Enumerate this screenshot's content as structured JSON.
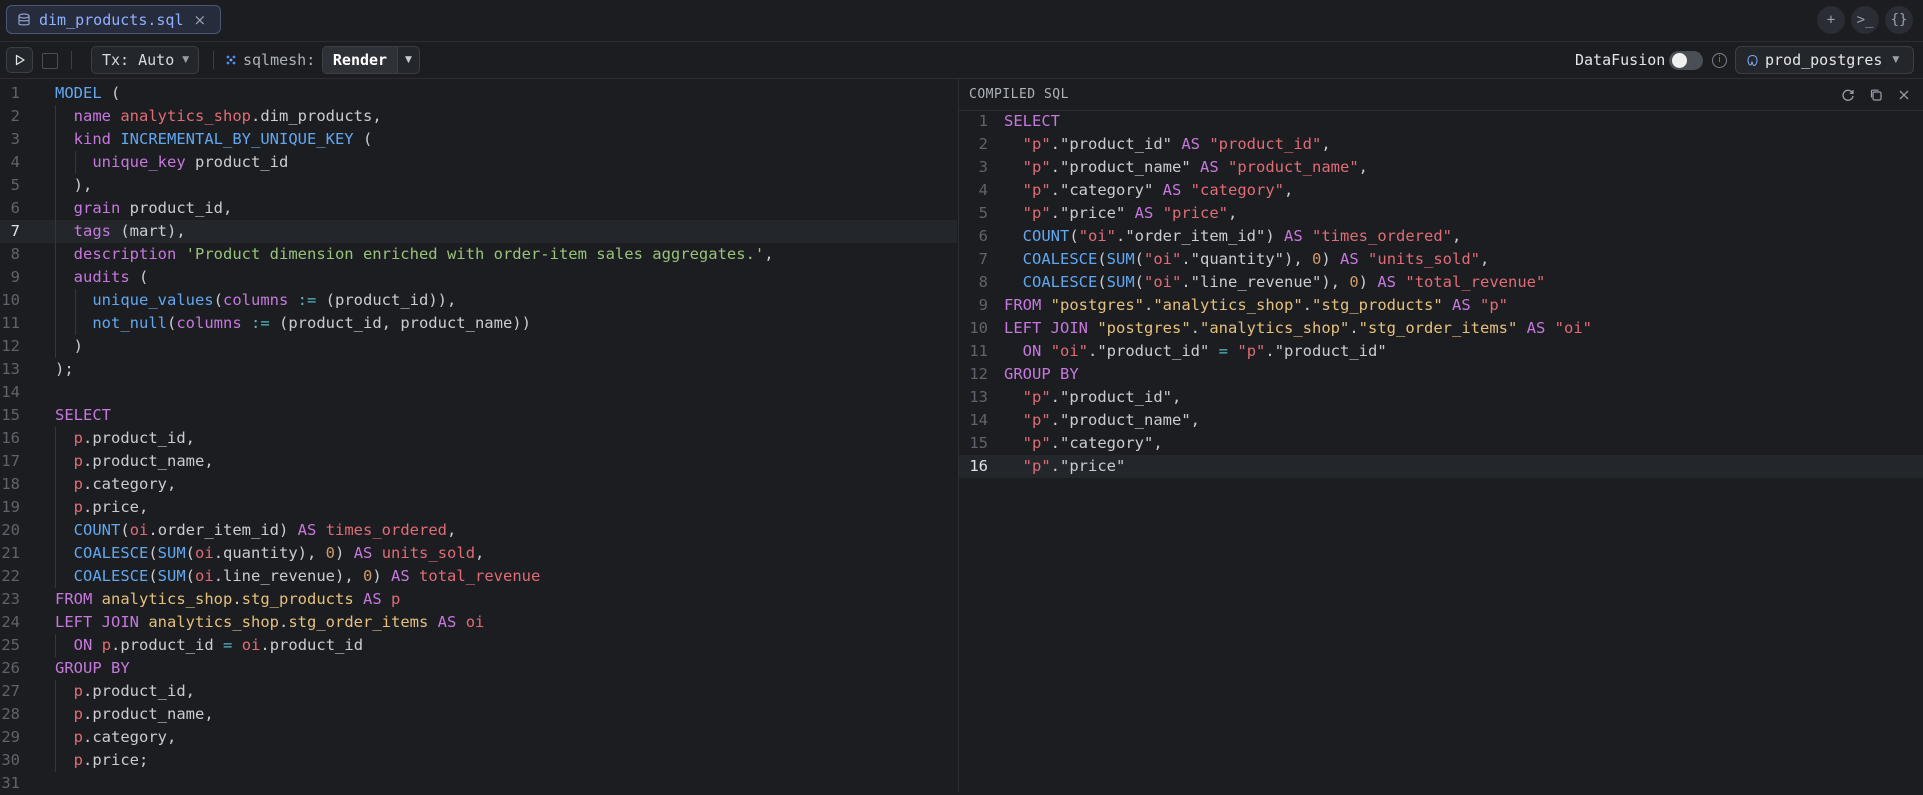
{
  "tab": {
    "label": "dim_products.sql",
    "close": "×"
  },
  "tab_actions": {
    "new": "+",
    "terminal": ">_",
    "braces": "{}"
  },
  "toolbar": {
    "tx_label": "Tx: Auto",
    "sqlmesh_label": "sqlmesh:",
    "render_label": "Render",
    "datafusion_label": "DataFusion",
    "datafusion_enabled": false,
    "info": "i",
    "connection": "prod_postgres"
  },
  "colors": {
    "keyword": "#c678dd",
    "builtin": "#61a8f0",
    "identifier": "#e06c75",
    "string": "#e5c07b",
    "green_string": "#98c379",
    "number": "#d19a66",
    "operator": "#56b6c2"
  },
  "left_editor": {
    "active_line": 7,
    "lines": [
      [
        [
          "kb",
          "MODEL"
        ],
        [
          "pl",
          " ("
        ]
      ],
      [
        [
          "pl",
          "  "
        ],
        [
          "kw",
          "name"
        ],
        [
          "pl",
          " "
        ],
        [
          "id",
          "analytics_shop"
        ],
        [
          "pl",
          ".dim_products,"
        ]
      ],
      [
        [
          "pl",
          "  "
        ],
        [
          "kw",
          "kind"
        ],
        [
          "pl",
          " "
        ],
        [
          "kb",
          "INCREMENTAL_BY_UNIQUE_KEY"
        ],
        [
          "pl",
          " ("
        ]
      ],
      [
        [
          "pl",
          "    "
        ],
        [
          "kw",
          "unique_key"
        ],
        [
          "pl",
          " product_id"
        ]
      ],
      [
        [
          "pl",
          "  ),"
        ]
      ],
      [
        [
          "pl",
          "  "
        ],
        [
          "kw",
          "grain"
        ],
        [
          "pl",
          " product_id,"
        ]
      ],
      [
        [
          "pl",
          "  "
        ],
        [
          "kw",
          "tags"
        ],
        [
          "pl",
          " (mart),"
        ]
      ],
      [
        [
          "pl",
          "  "
        ],
        [
          "kw",
          "description"
        ],
        [
          "pl",
          " "
        ],
        [
          "grn",
          "'Product dimension enriched with order-item sales aggregates.'"
        ],
        [
          "pl",
          ","
        ]
      ],
      [
        [
          "pl",
          "  "
        ],
        [
          "kw",
          "audits"
        ],
        [
          "pl",
          " ("
        ]
      ],
      [
        [
          "pl",
          "    "
        ],
        [
          "kb",
          "unique_values"
        ],
        [
          "pl",
          "("
        ],
        [
          "kw",
          "columns"
        ],
        [
          "pl",
          " "
        ],
        [
          "op",
          ":="
        ],
        [
          "pl",
          " (product_id)),"
        ]
      ],
      [
        [
          "pl",
          "    "
        ],
        [
          "kb",
          "not_null"
        ],
        [
          "pl",
          "("
        ],
        [
          "kw",
          "columns"
        ],
        [
          "pl",
          " "
        ],
        [
          "op",
          ":="
        ],
        [
          "pl",
          " (product_id, product_name))"
        ]
      ],
      [
        [
          "pl",
          "  )"
        ]
      ],
      [
        [
          "pl",
          ");"
        ]
      ],
      [],
      [
        [
          "kw",
          "SELECT"
        ]
      ],
      [
        [
          "pl",
          "  "
        ],
        [
          "id",
          "p"
        ],
        [
          "pl",
          ".product_id,"
        ]
      ],
      [
        [
          "pl",
          "  "
        ],
        [
          "id",
          "p"
        ],
        [
          "pl",
          ".product_name,"
        ]
      ],
      [
        [
          "pl",
          "  "
        ],
        [
          "id",
          "p"
        ],
        [
          "pl",
          ".category,"
        ]
      ],
      [
        [
          "pl",
          "  "
        ],
        [
          "id",
          "p"
        ],
        [
          "pl",
          ".price,"
        ]
      ],
      [
        [
          "pl",
          "  "
        ],
        [
          "kb",
          "COUNT"
        ],
        [
          "pl",
          "("
        ],
        [
          "id",
          "oi"
        ],
        [
          "pl",
          ".order_item_id) "
        ],
        [
          "kw",
          "AS"
        ],
        [
          "pl",
          " "
        ],
        [
          "id",
          "times_ordered"
        ],
        [
          "pl",
          ","
        ]
      ],
      [
        [
          "pl",
          "  "
        ],
        [
          "kb",
          "COALESCE"
        ],
        [
          "pl",
          "("
        ],
        [
          "kb",
          "SUM"
        ],
        [
          "pl",
          "("
        ],
        [
          "id",
          "oi"
        ],
        [
          "pl",
          ".quantity), "
        ],
        [
          "num",
          "0"
        ],
        [
          "pl",
          ") "
        ],
        [
          "kw",
          "AS"
        ],
        [
          "pl",
          " "
        ],
        [
          "id",
          "units_sold"
        ],
        [
          "pl",
          ","
        ]
      ],
      [
        [
          "pl",
          "  "
        ],
        [
          "kb",
          "COALESCE"
        ],
        [
          "pl",
          "("
        ],
        [
          "kb",
          "SUM"
        ],
        [
          "pl",
          "("
        ],
        [
          "id",
          "oi"
        ],
        [
          "pl",
          ".line_revenue), "
        ],
        [
          "num",
          "0"
        ],
        [
          "pl",
          ") "
        ],
        [
          "kw",
          "AS"
        ],
        [
          "pl",
          " "
        ],
        [
          "id",
          "total_revenue"
        ]
      ],
      [
        [
          "kw",
          "FROM"
        ],
        [
          "pl",
          " "
        ],
        [
          "str",
          "analytics_shop"
        ],
        [
          "pl",
          "."
        ],
        [
          "str",
          "stg_products"
        ],
        [
          "pl",
          " "
        ],
        [
          "kw",
          "AS"
        ],
        [
          "pl",
          " "
        ],
        [
          "id",
          "p"
        ]
      ],
      [
        [
          "kw",
          "LEFT JOIN"
        ],
        [
          "pl",
          " "
        ],
        [
          "str",
          "analytics_shop"
        ],
        [
          "pl",
          "."
        ],
        [
          "str",
          "stg_order_items"
        ],
        [
          "pl",
          " "
        ],
        [
          "kw",
          "AS"
        ],
        [
          "pl",
          " "
        ],
        [
          "id",
          "oi"
        ]
      ],
      [
        [
          "pl",
          "  "
        ],
        [
          "kw",
          "ON"
        ],
        [
          "pl",
          " "
        ],
        [
          "id",
          "p"
        ],
        [
          "pl",
          ".product_id "
        ],
        [
          "op",
          "="
        ],
        [
          "pl",
          " "
        ],
        [
          "id",
          "oi"
        ],
        [
          "pl",
          ".product_id"
        ]
      ],
      [
        [
          "kw",
          "GROUP BY"
        ]
      ],
      [
        [
          "pl",
          "  "
        ],
        [
          "id",
          "p"
        ],
        [
          "pl",
          ".product_id,"
        ]
      ],
      [
        [
          "pl",
          "  "
        ],
        [
          "id",
          "p"
        ],
        [
          "pl",
          ".product_name,"
        ]
      ],
      [
        [
          "pl",
          "  "
        ],
        [
          "id",
          "p"
        ],
        [
          "pl",
          ".category,"
        ]
      ],
      [
        [
          "pl",
          "  "
        ],
        [
          "id",
          "p"
        ],
        [
          "pl",
          ".price;"
        ]
      ],
      []
    ]
  },
  "right_editor": {
    "title": "COMPILED SQL",
    "active_line": 16,
    "lines": [
      [
        [
          "kw",
          "SELECT"
        ]
      ],
      [
        [
          "pl",
          "  "
        ],
        [
          "id",
          "\"p\""
        ],
        [
          "pl",
          ".\"product_id\" "
        ],
        [
          "kw",
          "AS"
        ],
        [
          "pl",
          " "
        ],
        [
          "id",
          "\"product_id\""
        ],
        [
          "pl",
          ","
        ]
      ],
      [
        [
          "pl",
          "  "
        ],
        [
          "id",
          "\"p\""
        ],
        [
          "pl",
          ".\"product_name\" "
        ],
        [
          "kw",
          "AS"
        ],
        [
          "pl",
          " "
        ],
        [
          "id",
          "\"product_name\""
        ],
        [
          "pl",
          ","
        ]
      ],
      [
        [
          "pl",
          "  "
        ],
        [
          "id",
          "\"p\""
        ],
        [
          "pl",
          ".\"category\" "
        ],
        [
          "kw",
          "AS"
        ],
        [
          "pl",
          " "
        ],
        [
          "id",
          "\"category\""
        ],
        [
          "pl",
          ","
        ]
      ],
      [
        [
          "pl",
          "  "
        ],
        [
          "id",
          "\"p\""
        ],
        [
          "pl",
          ".\"price\" "
        ],
        [
          "kw",
          "AS"
        ],
        [
          "pl",
          " "
        ],
        [
          "id",
          "\"price\""
        ],
        [
          "pl",
          ","
        ]
      ],
      [
        [
          "pl",
          "  "
        ],
        [
          "kb",
          "COUNT"
        ],
        [
          "pl",
          "("
        ],
        [
          "id",
          "\"oi\""
        ],
        [
          "pl",
          ".\"order_item_id\") "
        ],
        [
          "kw",
          "AS"
        ],
        [
          "pl",
          " "
        ],
        [
          "id",
          "\"times_ordered\""
        ],
        [
          "pl",
          ","
        ]
      ],
      [
        [
          "pl",
          "  "
        ],
        [
          "kb",
          "COALESCE"
        ],
        [
          "pl",
          "("
        ],
        [
          "kb",
          "SUM"
        ],
        [
          "pl",
          "("
        ],
        [
          "id",
          "\"oi\""
        ],
        [
          "pl",
          ".\"quantity\"), "
        ],
        [
          "num",
          "0"
        ],
        [
          "pl",
          ") "
        ],
        [
          "kw",
          "AS"
        ],
        [
          "pl",
          " "
        ],
        [
          "id",
          "\"units_sold\""
        ],
        [
          "pl",
          ","
        ]
      ],
      [
        [
          "pl",
          "  "
        ],
        [
          "kb",
          "COALESCE"
        ],
        [
          "pl",
          "("
        ],
        [
          "kb",
          "SUM"
        ],
        [
          "pl",
          "("
        ],
        [
          "id",
          "\"oi\""
        ],
        [
          "pl",
          ".\"line_revenue\"), "
        ],
        [
          "num",
          "0"
        ],
        [
          "pl",
          ") "
        ],
        [
          "kw",
          "AS"
        ],
        [
          "pl",
          " "
        ],
        [
          "id",
          "\"total_revenue\""
        ]
      ],
      [
        [
          "kw",
          "FROM"
        ],
        [
          "pl",
          " "
        ],
        [
          "str",
          "\"postgres\""
        ],
        [
          "pl",
          "."
        ],
        [
          "str",
          "\"analytics_shop\""
        ],
        [
          "pl",
          "."
        ],
        [
          "str",
          "\"stg_products\""
        ],
        [
          "pl",
          " "
        ],
        [
          "kw",
          "AS"
        ],
        [
          "pl",
          " "
        ],
        [
          "id",
          "\"p\""
        ]
      ],
      [
        [
          "kw",
          "LEFT JOIN"
        ],
        [
          "pl",
          " "
        ],
        [
          "str",
          "\"postgres\""
        ],
        [
          "pl",
          "."
        ],
        [
          "str",
          "\"analytics_shop\""
        ],
        [
          "pl",
          "."
        ],
        [
          "str",
          "\"stg_order_items\""
        ],
        [
          "pl",
          " "
        ],
        [
          "kw",
          "AS"
        ],
        [
          "pl",
          " "
        ],
        [
          "id",
          "\"oi\""
        ]
      ],
      [
        [
          "pl",
          "  "
        ],
        [
          "kw",
          "ON"
        ],
        [
          "pl",
          " "
        ],
        [
          "id",
          "\"oi\""
        ],
        [
          "pl",
          ".\"product_id\" "
        ],
        [
          "op",
          "="
        ],
        [
          "pl",
          " "
        ],
        [
          "id",
          "\"p\""
        ],
        [
          "pl",
          ".\"product_id\""
        ]
      ],
      [
        [
          "kw",
          "GROUP BY"
        ]
      ],
      [
        [
          "pl",
          "  "
        ],
        [
          "id",
          "\"p\""
        ],
        [
          "pl",
          ".\"product_id\","
        ]
      ],
      [
        [
          "pl",
          "  "
        ],
        [
          "id",
          "\"p\""
        ],
        [
          "pl",
          ".\"product_name\","
        ]
      ],
      [
        [
          "pl",
          "  "
        ],
        [
          "id",
          "\"p\""
        ],
        [
          "pl",
          ".\"category\","
        ]
      ],
      [
        [
          "pl",
          "  "
        ],
        [
          "id",
          "\"p\""
        ],
        [
          "pl",
          ".\"price\""
        ]
      ]
    ]
  }
}
